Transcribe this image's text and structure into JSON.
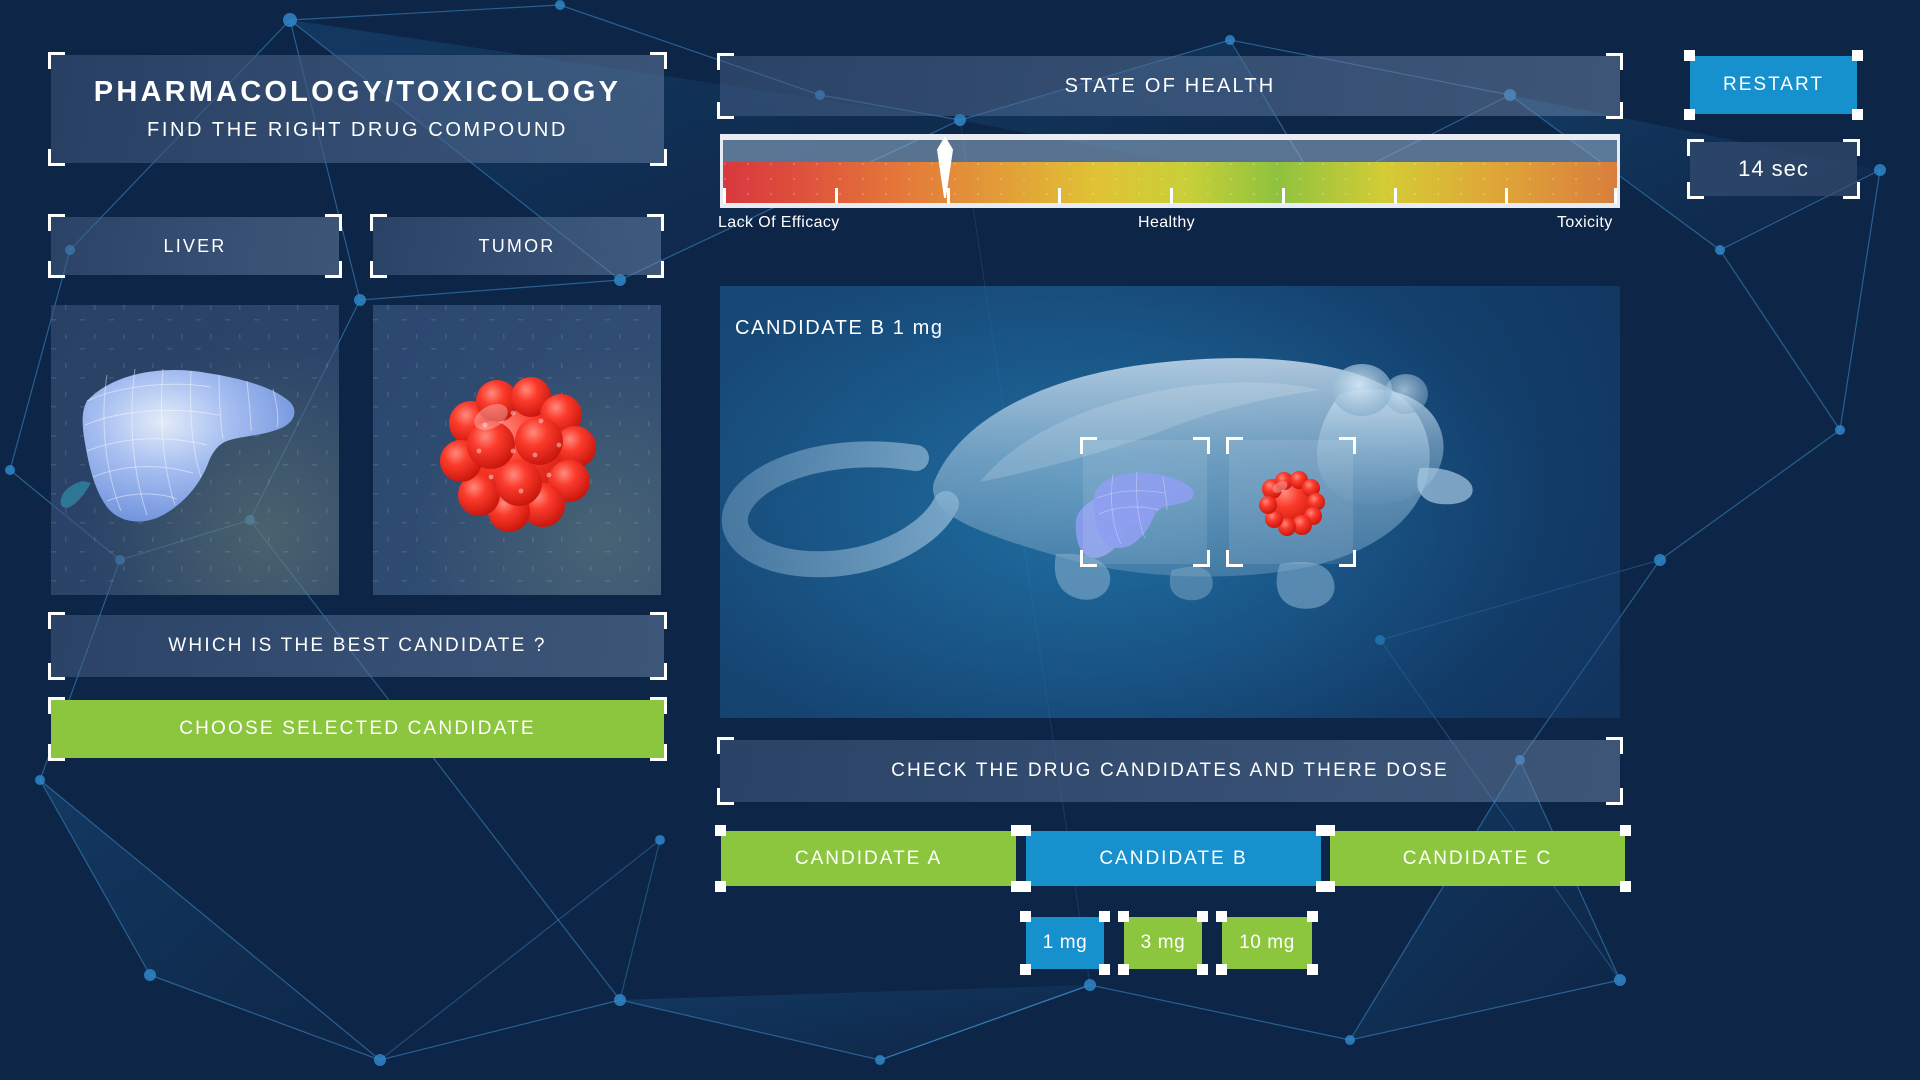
{
  "app": {
    "title_main": "PHARMACOLOGY/TOXICOLOGY",
    "title_sub": "FIND THE RIGHT DRUG COMPOUND"
  },
  "colors": {
    "accent_blue": "#1791ce",
    "accent_green": "#8cc63e",
    "panel_blue": "#3a5072",
    "background": "#0d2546",
    "white": "#ffffff"
  },
  "left": {
    "tabs": [
      {
        "label": "LIVER",
        "name": "liver"
      },
      {
        "label": "TUMOR",
        "name": "tumor"
      }
    ],
    "question": "WHICH IS THE BEST CANDIDATE ?",
    "choose_button": "CHOOSE SELECTED CANDIDATE"
  },
  "health": {
    "panel_title": "STATE OF HEALTH",
    "labels": {
      "left": "Lack Of Efficacy",
      "center": "Healthy",
      "right": "Toxicity"
    },
    "needle_percent": 25,
    "tick_percents": [
      0,
      12.5,
      25,
      37.5,
      50,
      62.5,
      75,
      87.5,
      100
    ]
  },
  "viewer": {
    "candidate_label": "CANDIDATE B 1 mg",
    "organ_hotspots": [
      {
        "name": "liver"
      },
      {
        "name": "tumor"
      }
    ]
  },
  "doses_section": {
    "prompt": "CHECK THE DRUG CANDIDATES AND THERE DOSE",
    "candidates": [
      {
        "label": "CANDIDATE A",
        "state": "unselected",
        "color": "#8cc63e"
      },
      {
        "label": "CANDIDATE B",
        "state": "selected",
        "color": "#1791ce"
      },
      {
        "label": "CANDIDATE C",
        "state": "unselected",
        "color": "#8cc63e"
      }
    ],
    "doses": [
      {
        "label": "1 mg",
        "state": "selected",
        "color": "#1791ce"
      },
      {
        "label": "3 mg",
        "state": "unselected",
        "color": "#8cc63e"
      },
      {
        "label": "10 mg",
        "state": "unselected",
        "color": "#8cc63e"
      }
    ]
  },
  "right": {
    "restart_button": "RESTART",
    "timer": "14 sec"
  }
}
